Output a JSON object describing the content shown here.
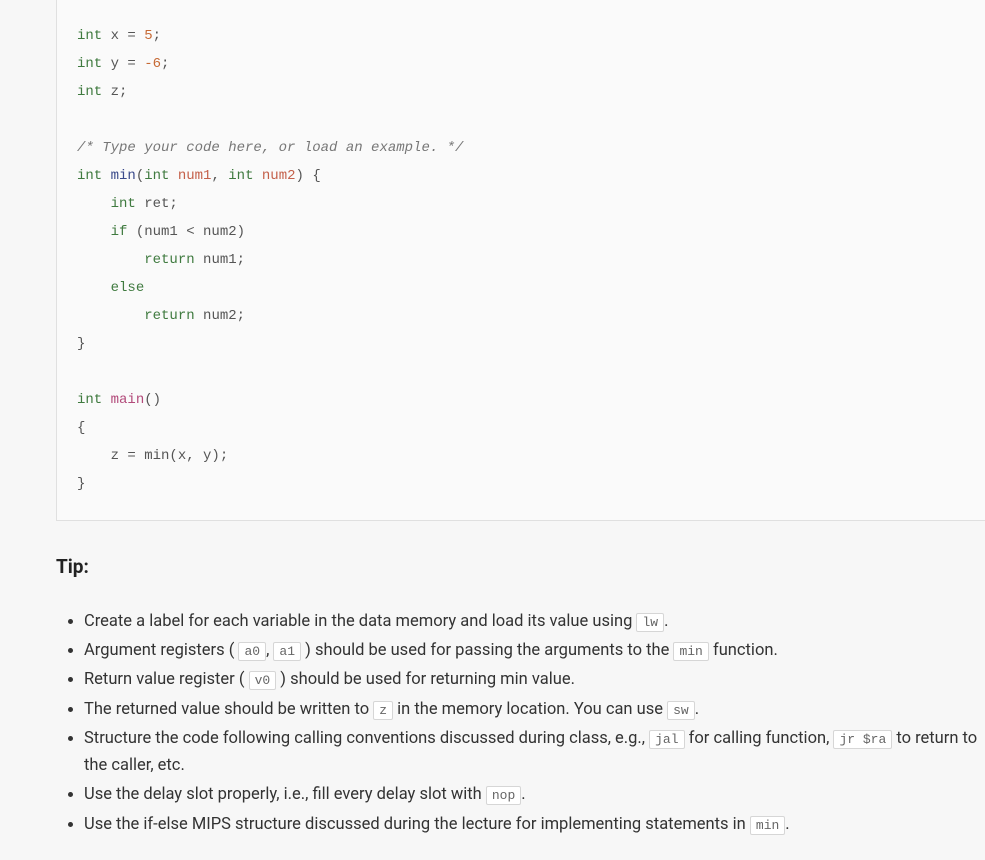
{
  "code": {
    "l1_kw": "int",
    "l1_rest": " x = ",
    "l1_num": "5",
    "l1_end": ";",
    "l2_kw": "int",
    "l2_rest": " y = ",
    "l2_num": "-6",
    "l2_end": ";",
    "l3_kw": "int",
    "l3_rest": " z;",
    "l4_comment": "/* Type your code here, or load an example. */",
    "l5_kw": "int",
    "l5_fn": " min",
    "l5_p1_t": "int",
    "l5_p1_n": " num1",
    "l5_sep": ", ",
    "l5_p2_t": "int",
    "l5_p2_n": " num2",
    "l5_end": ") {",
    "l6_kw": "int",
    "l6_rest": " ret;",
    "l7_kw": "if",
    "l7_rest": " (num1 < num2)",
    "l8_kw": "return",
    "l8_rest": " num1;",
    "l9_kw": "else",
    "l10_kw": "return",
    "l10_rest": " num2;",
    "l11": "}",
    "l12_kw": "int",
    "l12_fn": " main",
    "l12_end": "()",
    "l13": "{",
    "l14": "    z = min(x, y);",
    "l15": "}"
  },
  "tip_label": "Tip:",
  "tips": {
    "t1_a": "Create a label for each variable in the data memory and load its value using ",
    "t1_code": "lw",
    "t1_b": ".",
    "t2_a": "Argument registers ( ",
    "t2_c1": "a0",
    "t2_sep": ", ",
    "t2_c2": "a1",
    "t2_b": " ) should be used for passing the arguments to the ",
    "t2_c3": "min",
    "t2_c": " function.",
    "t3_a": "Return value register ( ",
    "t3_c1": "v0",
    "t3_b": " ) should be used for returning min value.",
    "t4_a": "The returned value should be written to ",
    "t4_c1": "z",
    "t4_b": " in the memory location. You can use ",
    "t4_c2": "sw",
    "t4_c": ".",
    "t5_a": "Structure the code following calling conventions discussed during class, e.g., ",
    "t5_c1": "jal",
    "t5_b": " for calling function, ",
    "t5_c2": "jr $ra",
    "t5_c": " to return to the caller, etc.",
    "t6_a": "Use the delay slot properly, i.e., fill every delay slot with ",
    "t6_c1": "nop",
    "t6_b": ".",
    "t7_a": "Use the if-else MIPS structure discussed during the lecture for implementing statements in ",
    "t7_c1": "min",
    "t7_b": "."
  }
}
